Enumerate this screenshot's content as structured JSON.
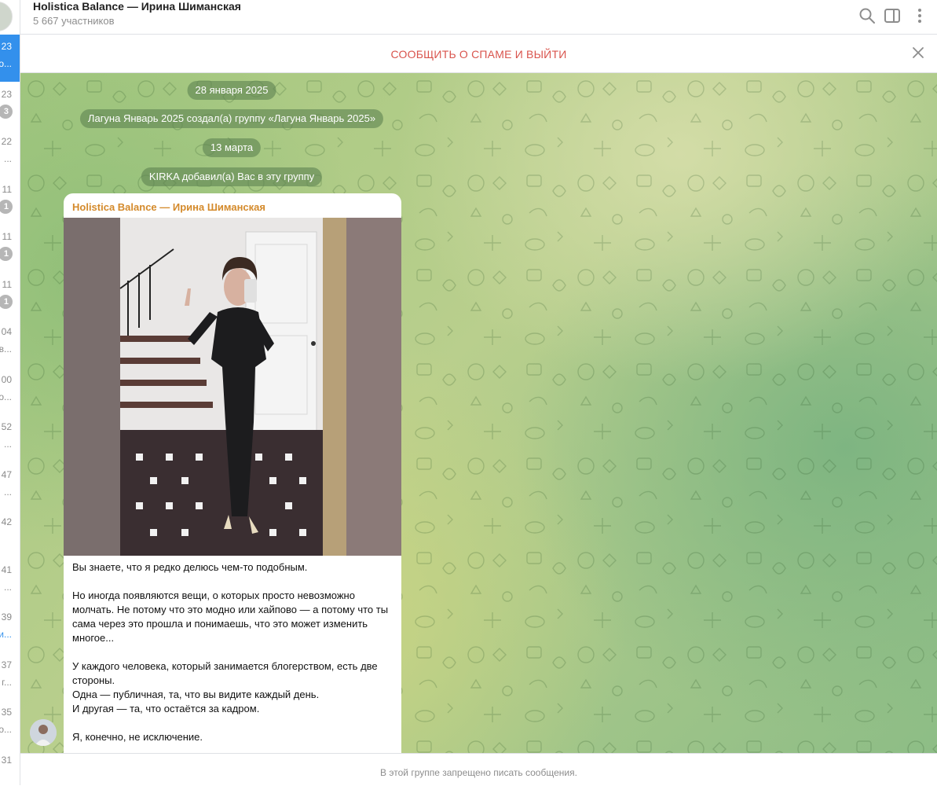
{
  "header": {
    "title": "Holistica Balance — Ирина Шиманская",
    "subtitle": "5 667 участников",
    "icons": [
      "search-icon",
      "sidebar-toggle-icon",
      "more-vertical-icon"
    ]
  },
  "spam_bar": {
    "label": "СООБЩИТЬ О СПАМЕ И ВЫЙТИ",
    "close_icon": "close-icon"
  },
  "chat_list_strip": [
    {
      "time": "23",
      "snippet": "о...",
      "active": true
    },
    {
      "time": "23",
      "badge": "3"
    },
    {
      "time": "22",
      "snippet": "..."
    },
    {
      "time": "11",
      "badge": "1"
    },
    {
      "time": "11",
      "badge": "1"
    },
    {
      "time": "11",
      "badge": "1"
    },
    {
      "time": "04",
      "snippet": "в..."
    },
    {
      "time": "00",
      "snippet": "о..."
    },
    {
      "time": "52",
      "snippet": "..."
    },
    {
      "time": "47",
      "snippet": "..."
    },
    {
      "time": "42",
      "snippet": ""
    },
    {
      "time": "41",
      "snippet": "..."
    },
    {
      "time": "39",
      "snippet": "и...",
      "link": true
    },
    {
      "time": "37",
      "snippet": "г..."
    },
    {
      "time": "35",
      "snippet": "о..."
    },
    {
      "time": "31",
      "snippet": ""
    }
  ],
  "service_messages": [
    {
      "text": "28 января 2025"
    },
    {
      "text": "Лагуна Январь 2025 создал(а) группу «Лагуна Январь 2025»"
    },
    {
      "text": "13 марта"
    },
    {
      "text": "KIRKA добавил(а) Вас в эту группу"
    }
  ],
  "message": {
    "sender": "Holistica Balance — Ирина Шиманская",
    "paragraphs": [
      "Вы знаете, что я редко делюсь чем-то подобным.",
      "Но иногда появляются вещи, о которых просто невозможно молчать. Не потому что это модно или хайпово — а потому что ты сама через это прошла и понимаешь, что это может изменить многое...",
      "У каждого человека, который занимается блогерством, есть две стороны.\nОдна — публичная, та, что вы видите каждый день.\nИ другая — та, что остаётся за кадром.",
      "Я, конечно, не исключение."
    ]
  },
  "footer": {
    "text": "В этой группе запрещено писать сообщения."
  },
  "colors": {
    "accent": "#3390ec",
    "spam_red": "#d9544d",
    "sender": "#d48a2b",
    "service_bg": "#608452"
  }
}
